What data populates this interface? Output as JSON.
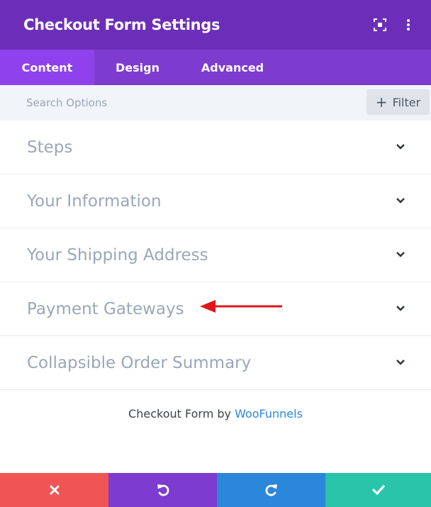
{
  "header": {
    "title": "Checkout Form Settings",
    "icons": [
      "expand-icon",
      "more-vertical-icon"
    ]
  },
  "tabs": [
    {
      "label": "Content",
      "active": true
    },
    {
      "label": "Design",
      "active": false
    },
    {
      "label": "Advanced",
      "active": false
    }
  ],
  "search": {
    "placeholder": "Search Options",
    "value": "",
    "filter_label": "Filter",
    "filter_icon": "plus-icon"
  },
  "sections": [
    {
      "label": "Steps"
    },
    {
      "label": "Your Information"
    },
    {
      "label": "Your Shipping Address"
    },
    {
      "label": "Payment Gateways"
    },
    {
      "label": "Collapsible Order Summary"
    }
  ],
  "credit": {
    "prefix": "Checkout Form by",
    "link": "WooFunnels"
  },
  "footer": {
    "buttons": [
      {
        "name": "discard",
        "icon": "close-icon",
        "color": "#ef5555"
      },
      {
        "name": "undo",
        "icon": "undo-icon",
        "color": "#7e3bd0"
      },
      {
        "name": "redo",
        "icon": "redo-icon",
        "color": "#2b87da"
      },
      {
        "name": "save",
        "icon": "check-icon",
        "color": "#29c4a9"
      }
    ]
  },
  "colors": {
    "header_bg": "#6c2eb9",
    "tabs_bg": "#7e3bd0",
    "active_tab_bg": "#8f42ec",
    "section_text": "#9aa7b8",
    "link": "#2b87da",
    "annotation_arrow": "#e0161b"
  }
}
